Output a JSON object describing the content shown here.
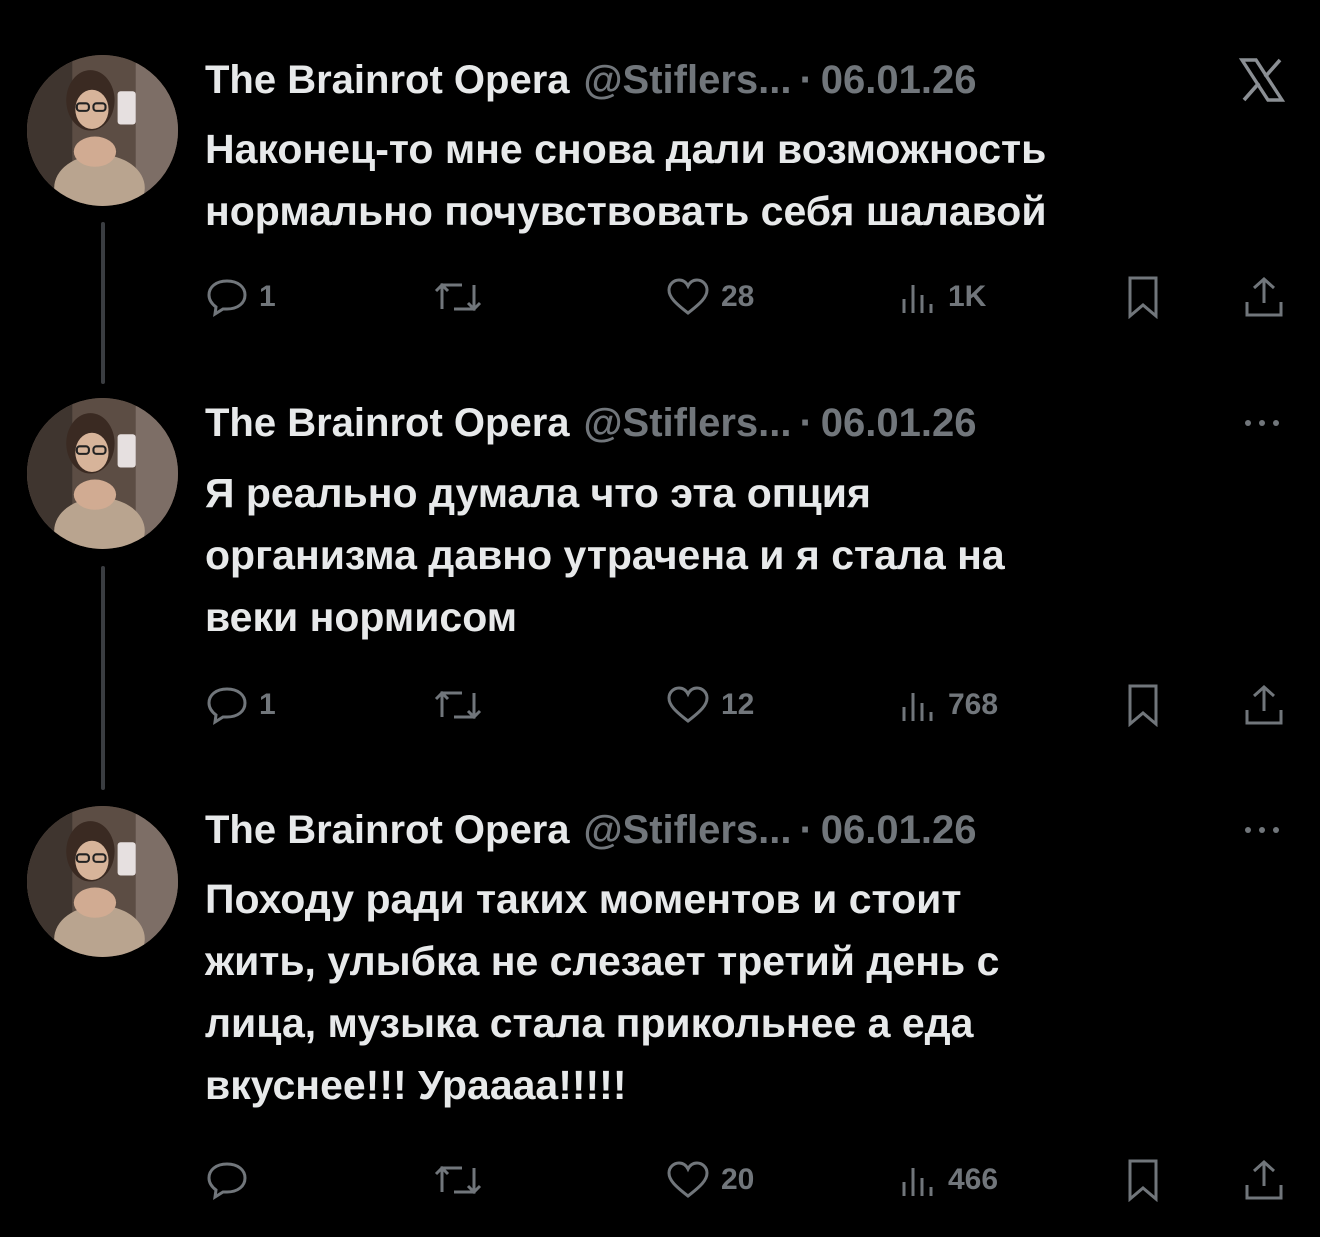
{
  "thread": {
    "tweets": [
      {
        "author_name": "The Brainrot Opera",
        "author_handle": "@Stiflers...",
        "separator": "·",
        "date": "06.01.26",
        "corner_icon": "x-logo-icon",
        "text": "Наконец-то мне снова дали возможность\nнормально почувствовать себя шалавой",
        "replies": "1",
        "retweets": "",
        "likes": "28",
        "views": "1K"
      },
      {
        "author_name": "The Brainrot Opera",
        "author_handle": "@Stiflers...",
        "separator": "·",
        "date": "06.01.26",
        "corner_icon": "more-icon",
        "text": "Я реально думала что эта опция\nорганизма давно утрачена и я стала на\nвеки нормисом",
        "replies": "1",
        "retweets": "",
        "likes": "12",
        "views": "768"
      },
      {
        "author_name": "The Brainrot Opera",
        "author_handle": "@Stiflers...",
        "separator": "·",
        "date": "06.01.26",
        "corner_icon": "more-icon",
        "text": "Походу ради таких моментов и стоит\nжить, улыбка не слезает третий день с\nлица, музыка стала прикольнее а еда\nвкуснее!!! Ураааа!!!!!",
        "replies": "",
        "retweets": "",
        "likes": "20",
        "views": "466"
      }
    ]
  },
  "colors": {
    "background": "#000000",
    "primary_text": "#e7e9ea",
    "secondary_text": "#71767b",
    "thread_line": "#3a3d41"
  }
}
